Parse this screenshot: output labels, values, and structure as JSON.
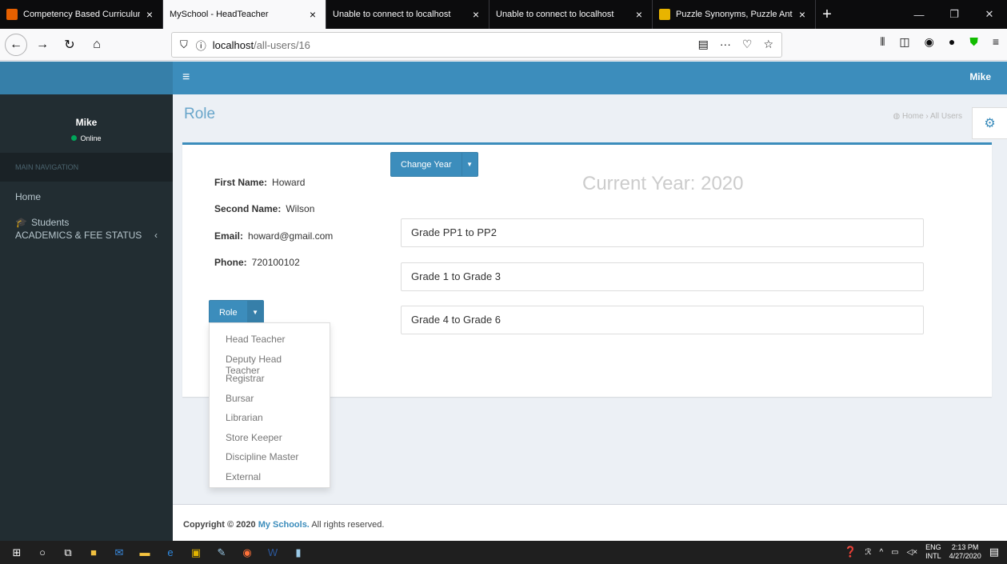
{
  "browser": {
    "tabs": [
      {
        "title": "Competency Based Curriculum",
        "favicon_color": "#e66000",
        "active": false
      },
      {
        "title": "MySchool - HeadTeacher",
        "favicon_color": "",
        "active": true
      },
      {
        "title": "Unable to connect to localhost",
        "favicon_color": "",
        "active": false
      },
      {
        "title": "Unable to connect to localhost",
        "favicon_color": "",
        "active": false
      },
      {
        "title": "Puzzle Synonyms, Puzzle Anton",
        "favicon_color": "#e8b400",
        "active": false
      }
    ],
    "url_host": "localhost",
    "url_path": "/all-users/16"
  },
  "header": {
    "user": "Mike"
  },
  "sidebar": {
    "user_name": "Mike",
    "status": "Online",
    "nav_header": "MAIN NAVIGATION",
    "items": [
      {
        "label": "Home"
      },
      {
        "label": "Students",
        "sub": "ACADEMICS & FEE STATUS"
      }
    ]
  },
  "page": {
    "title": "Role",
    "breadcrumb_home": "Home",
    "breadcrumb_current": "All Users"
  },
  "user_info": {
    "first_name_label": "First Name:",
    "first_name": "Howard",
    "second_name_label": "Second Name:",
    "second_name": "Wilson",
    "email_label": "Email:",
    "email": "howard@gmail.com",
    "phone_label": "Phone:",
    "phone": "720100102"
  },
  "change_year_label": "Change Year",
  "current_year": "Current Year: 2020",
  "grades": [
    "Grade PP1 to PP2",
    "Grade 1 to Grade 3",
    "Grade 4 to Grade 6"
  ],
  "role_button": "Role",
  "role_options": [
    "Head Teacher",
    "Deputy Head Teacher",
    "Registrar",
    "Bursar",
    "Librarian",
    "Store Keeper",
    "Discipline Master",
    "External"
  ],
  "footer": {
    "prefix": "Copyright © 2020 ",
    "brand": "My Schools.",
    "suffix": " All rights reserved."
  },
  "taskbar": {
    "lang_top": "ENG",
    "lang_bottom": "INTL",
    "time": "2:13 PM",
    "date": "4/27/2020"
  }
}
